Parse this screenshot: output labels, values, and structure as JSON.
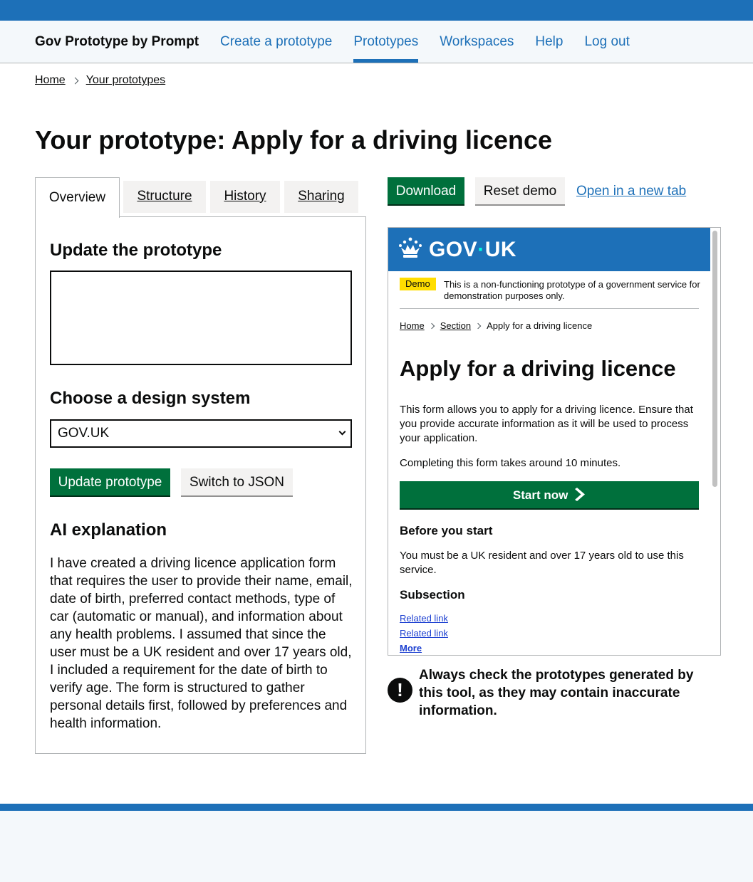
{
  "header": {
    "service_name": "Gov Prototype by Prompt",
    "nav": [
      {
        "label": "Create a prototype"
      },
      {
        "label": "Prototypes",
        "active": true
      },
      {
        "label": "Workspaces"
      },
      {
        "label": "Help"
      },
      {
        "label": "Log out"
      }
    ]
  },
  "breadcrumbs": [
    "Home",
    "Your prototypes"
  ],
  "page_title": "Your prototype: Apply for a driving licence",
  "tabs": [
    "Overview",
    "Structure",
    "History",
    "Sharing"
  ],
  "overview": {
    "update_heading": "Update the prototype",
    "update_value": "",
    "design_heading": "Choose a design system",
    "design_selected": "GOV.UK",
    "update_button": "Update prototype",
    "json_button": "Switch to JSON",
    "ai_heading": "AI explanation",
    "ai_text": "I have created a driving licence application form that requires the user to provide their name, email, date of birth, preferred contact methods, type of car (automatic or manual), and information about any health problems. I assumed that since the user must be a UK resident and over 17 years old, I included a requirement for the date of birth to verify age. The form is structured to gather personal details first, followed by preferences and health information."
  },
  "actions": {
    "download": "Download",
    "reset": "Reset demo",
    "open_tab": "Open in a new tab"
  },
  "preview": {
    "logo_text": "GOV",
    "logo_text_2": "UK",
    "demo_tag": "Demo",
    "demo_text": "This is a non-functioning prototype of a government service for demonstration purposes only.",
    "breadcrumbs": [
      "Home",
      "Section",
      "Apply for a driving licence"
    ],
    "title": "Apply for a driving licence",
    "intro": "This form allows you to apply for a driving licence. Ensure that you provide accurate information as it will be used to process your application.",
    "time": "Completing this form takes around 10 minutes.",
    "start_button": "Start now",
    "before_heading": "Before you start",
    "before_text": "You must be a UK resident and over 17 years old to use this service.",
    "subsection_heading": "Subsection",
    "links": [
      "Related link",
      "Related link",
      "More"
    ]
  },
  "warning": {
    "icon": "!",
    "text": "Always check the prototypes generated by this tool, as they may contain inaccurate information."
  },
  "colors": {
    "brand_blue": "#1d70b8",
    "button_green": "#00703c",
    "demo_yellow": "#ffdd00"
  }
}
